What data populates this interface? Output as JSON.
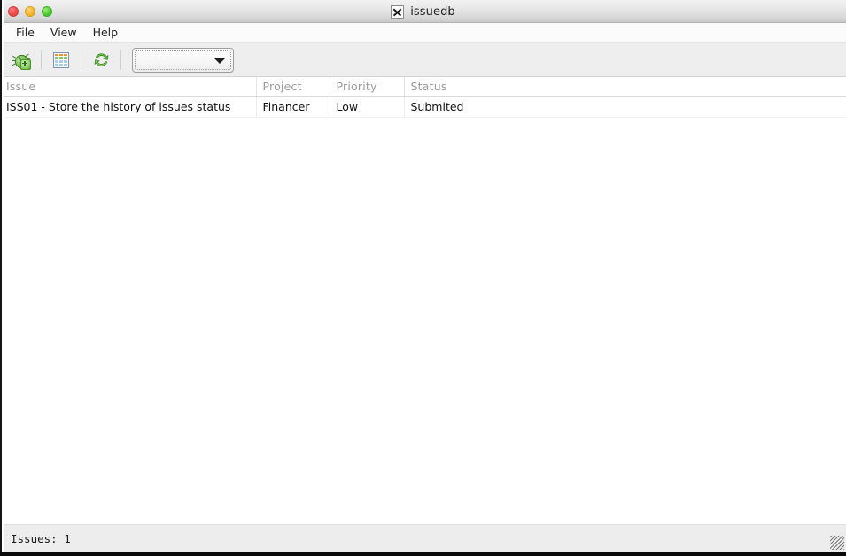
{
  "window": {
    "title": "issuedb",
    "app_icon": "x-window-icon",
    "controls": {
      "close": "close-button",
      "minimize": "minimize-button",
      "maximize": "maximize-button"
    }
  },
  "menubar": {
    "items": [
      {
        "label": "File"
      },
      {
        "label": "View"
      },
      {
        "label": "Help"
      }
    ]
  },
  "toolbar": {
    "buttons": [
      {
        "icon": "add-bug-icon",
        "tooltip": "New Issue"
      },
      {
        "icon": "spreadsheet-icon",
        "tooltip": "Report"
      },
      {
        "icon": "refresh-icon",
        "tooltip": "Refresh"
      }
    ],
    "filter_combo": {
      "value": "",
      "placeholder": "",
      "arrow_icon": "chevron-down-icon"
    }
  },
  "table": {
    "columns": [
      {
        "key": "issue",
        "label": "Issue"
      },
      {
        "key": "project",
        "label": "Project"
      },
      {
        "key": "priority",
        "label": "Priority"
      },
      {
        "key": "status",
        "label": "Status"
      }
    ],
    "rows": [
      {
        "issue": "ISS01 - Store the history of issues status",
        "project": "Financer",
        "priority": "Low",
        "status": "Submited"
      }
    ]
  },
  "statusbar": {
    "text": "Issues: 1",
    "grip_icon": "resize-grip-icon"
  },
  "colors": {
    "titlebar_top": "#f2f2f2",
    "titlebar_bottom": "#c9c9c9",
    "toolbar_bg": "#eeeeee",
    "statusbar_bg": "#ededed",
    "header_text": "#9b9b9b",
    "body_text": "#111111",
    "close_dot": "#f24a46",
    "minimize_dot": "#f7b32b",
    "maximize_dot": "#4fc92e",
    "icon_green": "#72c04c"
  }
}
